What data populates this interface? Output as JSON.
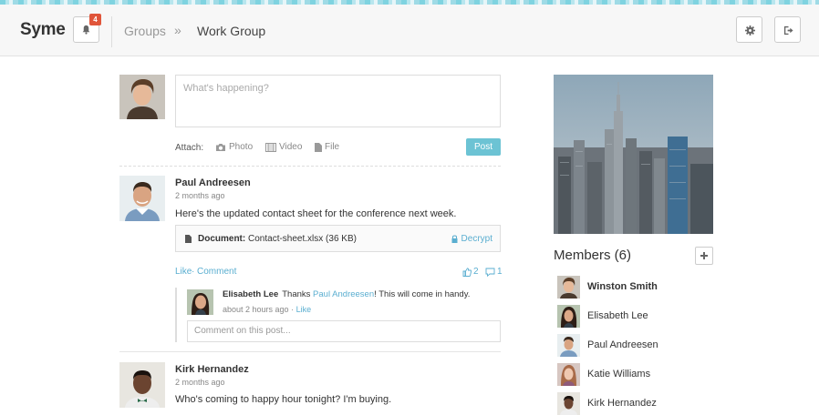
{
  "header": {
    "logo": "Syme",
    "notification_count": "4",
    "breadcrumb": {
      "groups": "Groups",
      "separator": "»",
      "current": "Work Group"
    }
  },
  "composer": {
    "placeholder": "What's happening?",
    "attach_label": "Attach:",
    "attach_photo": "Photo",
    "attach_video": "Video",
    "attach_file": "File",
    "post_label": "Post"
  },
  "posts": [
    {
      "author": "Paul Andreesen",
      "time": "2 months ago",
      "text": "Here's the updated contact sheet for the conference next week.",
      "document": {
        "label": "Document:",
        "filename": "Contact-sheet.xlsx (36 KB)",
        "action": "Decrypt"
      },
      "actions": {
        "like": "Like",
        "separator": "·",
        "comment": "Comment"
      },
      "likes": "2",
      "comments": "1",
      "comment_items": [
        {
          "author": "Elisabeth Lee",
          "text_before": "Thanks ",
          "mention": "Paul Andreesen",
          "text_after": "! This will come in handy.",
          "time": "about 2 hours ago",
          "meta_sep": "·",
          "like": "Like"
        }
      ],
      "comment_placeholder": "Comment on this post..."
    },
    {
      "author": "Kirk Hernandez",
      "time": "2 months ago",
      "text": "Who's coming to happy hour tonight? I'm buying."
    }
  ],
  "sidebar": {
    "members_title": "Members (6)",
    "members": [
      {
        "name": "Winston Smith",
        "bold": true
      },
      {
        "name": "Elisabeth Lee",
        "bold": false
      },
      {
        "name": "Paul Andreesen",
        "bold": false
      },
      {
        "name": "Katie Williams",
        "bold": false
      },
      {
        "name": "Kirk Hernandez",
        "bold": false
      }
    ]
  },
  "colors": {
    "accent": "#5aaed0",
    "post_button": "#6cc3d4",
    "badge": "#e0553a"
  }
}
